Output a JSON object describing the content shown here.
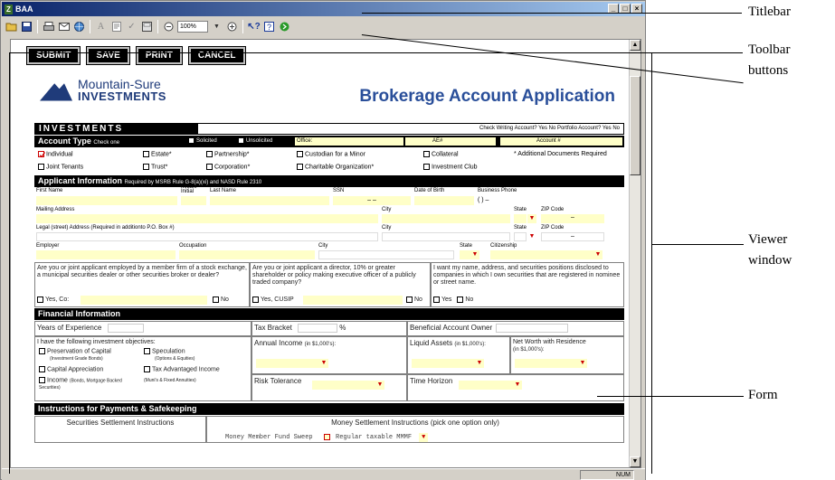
{
  "window": {
    "app_icon": "Z",
    "title": "BAA",
    "min": "_",
    "max": "□",
    "close": "×"
  },
  "toolbar": {
    "zoom": "100%"
  },
  "statusbar": {
    "num": "NUM"
  },
  "form_buttons": {
    "submit": "SUBMIT",
    "save": "SAVE",
    "print": "PRINT",
    "cancel": "CANCEL"
  },
  "logo": {
    "line1": "Mountain-Sure",
    "line2": "INVESTMENTS"
  },
  "doc_title": "Brokerage Account Application",
  "investments": {
    "header": "INVESTMENTS",
    "right_text": "Check Writing Account? Yes  No    Portfolio Account? Yes  No"
  },
  "account_type": {
    "header": "Account Type",
    "hint": "Check one",
    "solicited": "Solicited",
    "unsolicited": "Unsolicited",
    "office": "Office:",
    "ae": "AE#",
    "account": "Account #",
    "options_row1": [
      "Individual",
      "Estate*",
      "Partnership*",
      "Custodian for a Minor",
      "Collateral",
      "* Additional Documents Required"
    ],
    "options_row2": [
      "Joint Tenants",
      "Trust*",
      "Corporation*",
      "Charitable Organization*",
      "Investment Club"
    ]
  },
  "applicant": {
    "header": "Applicant Information",
    "note": "Required by MSRB Rule G-8(a)(xi) and NASD Rule 2310",
    "first_name": "First Name",
    "middle_initial": "Middle Initial",
    "last_name": "Last Name",
    "ssn": "SSN",
    "ssn_value": "–  –",
    "dob": "Date of Birth",
    "business_phone": "Business Phone",
    "phone_value": "(   )   –",
    "mailing_address": "Mailing Address",
    "city": "City",
    "state": "State",
    "zip": "ZIP Code",
    "legal_address": "Legal (street) Address (Required in additionto P.O. Box #)",
    "employer": "Employer",
    "occupation": "Occupation",
    "citizenship": "Citizenship",
    "zip_value": "–"
  },
  "questions": {
    "q1": "Are you or joint applicant employed by a member firm of a stock exchange, a municipal securities dealer or other securities broker or dealer?",
    "q1_yes": "Yes, Co:",
    "q1_no": "No",
    "q2": "Are you or joint applicant a director, 10% or greater shareholder or policy making executive officer of a publicly traded company?",
    "q2_yes": "Yes, CUSIP",
    "q2_no": "No",
    "q3": "I want my name, address, and securities positions disclosed to companies in which I own securities that are registered in nominee or street name.",
    "q3_yes": "Yes",
    "q3_no": "No"
  },
  "financial": {
    "header": "Financial Information",
    "years": "Years of Experience",
    "tax_bracket": "Tax Bracket",
    "percent": "%",
    "beneficial": "Beneficial Account Owner",
    "objectives": "I have the following investment objectives:",
    "obj1": "Preservation of Capital",
    "obj1_sub": "(Investment Grade Bonds)",
    "obj2": "Speculation",
    "obj2_sub": "(Options & Equities)",
    "obj3": "Capital Appreciation",
    "obj4": "Tax Advantaged Income",
    "obj5": "Income",
    "obj5_sub": "(Bonds, Mortgage Backed Securities)",
    "obj4_sub": "(Muni's & Fixed Annuities)",
    "annual_income": "Annual Income",
    "annual_income_unit": "(in $1,000's):",
    "liquid_assets": "Liquid Assets",
    "liquid_unit": "(in $1,000's):",
    "net_worth": "Net Worth with Residence",
    "net_worth_unit": "(in $1,000's):",
    "risk": "Risk Tolerance",
    "horizon": "Time Horizon"
  },
  "payments": {
    "header": "Instructions for Payments & Safekeeping",
    "col1": "Securities Settlement Instructions",
    "col2": "Money Settlement Instructions (pick one option only)",
    "partial1": "Money Member Fund Sweep",
    "partial2": "Regular taxable MMMF"
  },
  "annotations": {
    "titlebar": "Titlebar",
    "toolbar1": "Toolbar",
    "toolbar2": "buttons",
    "viewer1": "Viewer",
    "viewer2": "window",
    "form": "Form"
  }
}
